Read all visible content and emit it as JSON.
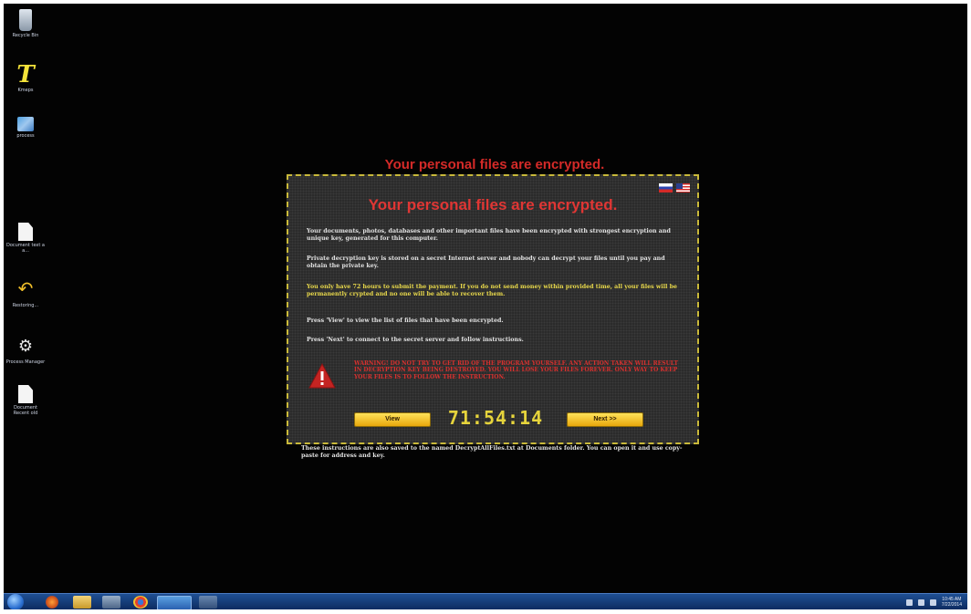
{
  "desktop": {
    "icons": [
      {
        "name": "recycle-bin-icon",
        "label": "Recycle Bin"
      },
      {
        "name": "typora-icon",
        "label": "Kmeps"
      },
      {
        "name": "computer-icon",
        "label": "process"
      },
      {
        "name": "document-icon",
        "label": "Document text a a..."
      },
      {
        "name": "restore-icon",
        "label": "Restoring..."
      },
      {
        "name": "manager-icon",
        "label": "Process Manager"
      },
      {
        "name": "document-icon",
        "label": "Document Recent old"
      }
    ]
  },
  "ransom_window": {
    "outer_title": "Your personal files are encrypted.",
    "inner_title": "Your personal files are encrypted.",
    "paragraphs": [
      "Your documents, photos, databases and other important files have been encrypted with strongest encryption and unique key, generated for this computer.",
      "Private decryption key is stored on a secret Internet server and nobody can decrypt your files until you pay and obtain the private key.",
      "You only have 72 hours to submit the payment. If you do not send money within provided time, all your files will be permanently crypted and no one will be able to recover them.",
      "Press 'View' to view the list of files that have been encrypted.",
      "Press 'Next' to connect to the secret server and follow instructions."
    ],
    "warning_text": "WARNING! DO NOT TRY TO GET RID OF THE PROGRAM YOURSELF. ANY ACTION TAKEN WILL RESULT IN DECRYPTION KEY BEING DESTROYED. YOU WILL LOSE YOUR FILES FOREVER. ONLY WAY TO KEEP YOUR FILES IS TO FOLLOW THE INSTRUCTION.",
    "view_button": "View",
    "timer": "71:54:14",
    "next_button": "Next >>",
    "footnote": "These instructions are also saved to the named DecryptAllFiles.txt at Documents folder. You can open it and use copy-paste for address and key.",
    "flags": [
      "russian-flag-icon",
      "us-flag-icon"
    ]
  },
  "taskbar": {
    "clock_time": "10:45 AM",
    "clock_date": "7/22/2014"
  },
  "colors": {
    "title_red": "#d42a28",
    "timer_yellow": "#e6d43c",
    "border_yellow": "#c9b93a",
    "taskbar_blue": "#1f4f93"
  }
}
